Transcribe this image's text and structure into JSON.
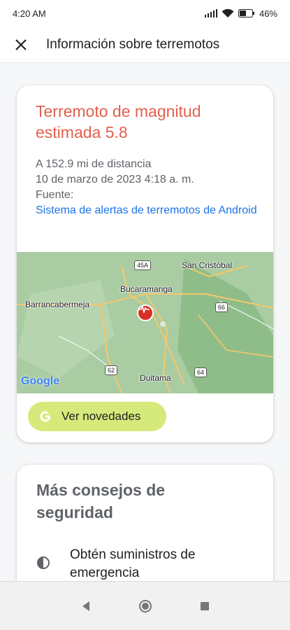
{
  "status_bar": {
    "time": "4:20 AM",
    "battery": "46"
  },
  "app_bar": {
    "title": "Información sobre terremotos",
    "close_icon": "close-icon"
  },
  "quake": {
    "title": "Terremoto de magnitud estimada 5.8",
    "distance": "A 152.9 mi de distancia",
    "datetime": "10 de marzo de 2023 4:18 a. m.",
    "source_label": "Fuente:",
    "source_link": "Sistema de alertas de terremotos de Android",
    "accent_color": "#e2604f"
  },
  "map": {
    "places": [
      "San Cristóbal",
      "Bucaramanga",
      "Barrancabermeja",
      "Duitama"
    ],
    "roads": [
      "45A",
      "66",
      "62",
      "64"
    ],
    "attribution": "Google"
  },
  "news_button": {
    "label": "Ver novedades",
    "color": "#d6ea7b"
  },
  "tips": {
    "title": "Más consejos de seguridad",
    "items": [
      {
        "icon": "contrast-icon",
        "text": "Obtén suministros de emergencia"
      }
    ]
  },
  "nav": {
    "back": "back-icon",
    "home": "home-icon",
    "recents": "recents-icon"
  }
}
